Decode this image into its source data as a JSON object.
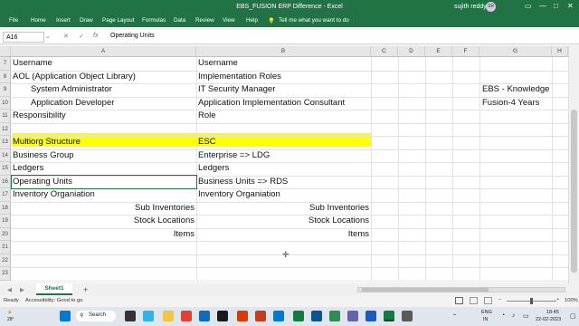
{
  "window": {
    "title": "EBS_FUSION ERP Difference  -  Excel",
    "user": "sujith reddy",
    "avatar_initials": "SR",
    "controls": {
      "minimize": "—",
      "maximize": "□",
      "close": "✕"
    }
  },
  "ribbon_tabs": [
    "File",
    "Home",
    "Insert",
    "Draw",
    "Page Layout",
    "Formulas",
    "Data",
    "Review",
    "View",
    "Help"
  ],
  "tell_me": "Tell me what you want to do",
  "formula_bar": {
    "name_box": "A16",
    "cancel": "✕",
    "confirm": "✓",
    "fx": "fx",
    "content": "Operating Units"
  },
  "columns": [
    "A",
    "B",
    "C",
    "D",
    "E",
    "F",
    "G",
    "H"
  ],
  "rows": [
    "7",
    "8",
    "9",
    "10",
    "11",
    "12",
    "13",
    "14",
    "15",
    "16",
    "17",
    "18",
    "19",
    "20",
    "21",
    "22",
    "23"
  ],
  "cells": {
    "a7": "Username",
    "b7": "Username",
    "a8": "AOL (Application Object Library)",
    "b8": "Implementation Roles",
    "a9": "System Administrator",
    "b9": "IT Security Manager",
    "g9": "EBS - Knowledge",
    "a10": "Application Developer",
    "b10": "Application Implementation Consultant",
    "g10": "Fusion-4 Years",
    "a11": "Responsibility",
    "b11": "Role",
    "a13": "Multiorg Structure",
    "b13": "ESC",
    "a14": "Business Group",
    "b14": "Enterprise  => LDG",
    "a15": "Ledgers",
    "b15": "Ledgers",
    "a16": "Operating Units",
    "b16": "Business Units   => RDS",
    "a17": "Inventory Organiation",
    "b17": "Inventory Organiation",
    "a18": "Sub Inventories",
    "b18": "Sub Inventories",
    "a19": "Stock Locations",
    "b19": "Stock Locations",
    "a20": "Items",
    "b20": "Items"
  },
  "highlight_color": "#ffff00",
  "sheet_tab": "Sheet1",
  "add_sheet": "+",
  "status": {
    "ready": "Ready",
    "accessibility": "Accessibility: Good to go",
    "zoom": "100%"
  },
  "taskbar": {
    "weather_temp": "28°",
    "search": "Search",
    "lang": "ENG",
    "lang2": "IN",
    "time": "18:45",
    "date": "22-02-2023"
  }
}
